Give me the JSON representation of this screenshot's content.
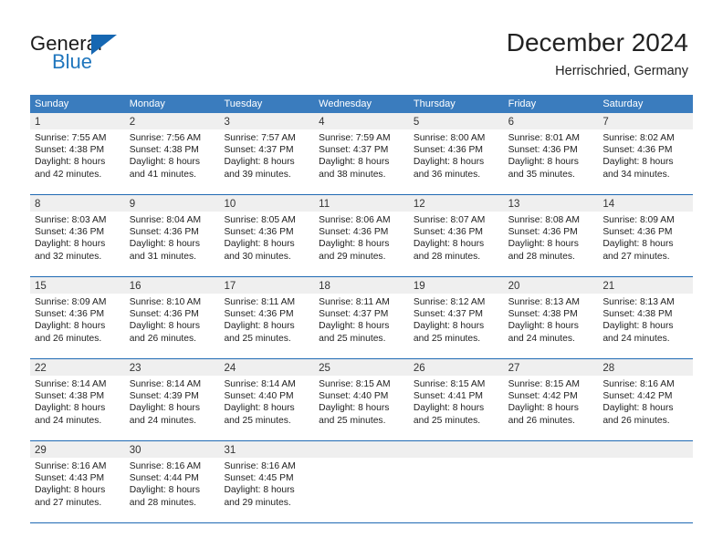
{
  "brand": {
    "name_part1": "General",
    "name_part2": "Blue",
    "triangle_color": "#1667b2",
    "blue_color": "#1f76bd"
  },
  "header": {
    "title": "December 2024",
    "location": "Herrischried, Germany"
  },
  "colors": {
    "header_blue": "#3a7cbe",
    "week_divider": "#1f69b3",
    "daynum_band": "#efefef",
    "text": "#222222"
  },
  "calendar": {
    "weekdays": [
      "Sunday",
      "Monday",
      "Tuesday",
      "Wednesday",
      "Thursday",
      "Friday",
      "Saturday"
    ],
    "weeks": [
      [
        {
          "day": "1",
          "sunrise": "Sunrise: 7:55 AM",
          "sunset": "Sunset: 4:38 PM",
          "daylight1": "Daylight: 8 hours",
          "daylight2": "and 42 minutes."
        },
        {
          "day": "2",
          "sunrise": "Sunrise: 7:56 AM",
          "sunset": "Sunset: 4:38 PM",
          "daylight1": "Daylight: 8 hours",
          "daylight2": "and 41 minutes."
        },
        {
          "day": "3",
          "sunrise": "Sunrise: 7:57 AM",
          "sunset": "Sunset: 4:37 PM",
          "daylight1": "Daylight: 8 hours",
          "daylight2": "and 39 minutes."
        },
        {
          "day": "4",
          "sunrise": "Sunrise: 7:59 AM",
          "sunset": "Sunset: 4:37 PM",
          "daylight1": "Daylight: 8 hours",
          "daylight2": "and 38 minutes."
        },
        {
          "day": "5",
          "sunrise": "Sunrise: 8:00 AM",
          "sunset": "Sunset: 4:36 PM",
          "daylight1": "Daylight: 8 hours",
          "daylight2": "and 36 minutes."
        },
        {
          "day": "6",
          "sunrise": "Sunrise: 8:01 AM",
          "sunset": "Sunset: 4:36 PM",
          "daylight1": "Daylight: 8 hours",
          "daylight2": "and 35 minutes."
        },
        {
          "day": "7",
          "sunrise": "Sunrise: 8:02 AM",
          "sunset": "Sunset: 4:36 PM",
          "daylight1": "Daylight: 8 hours",
          "daylight2": "and 34 minutes."
        }
      ],
      [
        {
          "day": "8",
          "sunrise": "Sunrise: 8:03 AM",
          "sunset": "Sunset: 4:36 PM",
          "daylight1": "Daylight: 8 hours",
          "daylight2": "and 32 minutes."
        },
        {
          "day": "9",
          "sunrise": "Sunrise: 8:04 AM",
          "sunset": "Sunset: 4:36 PM",
          "daylight1": "Daylight: 8 hours",
          "daylight2": "and 31 minutes."
        },
        {
          "day": "10",
          "sunrise": "Sunrise: 8:05 AM",
          "sunset": "Sunset: 4:36 PM",
          "daylight1": "Daylight: 8 hours",
          "daylight2": "and 30 minutes."
        },
        {
          "day": "11",
          "sunrise": "Sunrise: 8:06 AM",
          "sunset": "Sunset: 4:36 PM",
          "daylight1": "Daylight: 8 hours",
          "daylight2": "and 29 minutes."
        },
        {
          "day": "12",
          "sunrise": "Sunrise: 8:07 AM",
          "sunset": "Sunset: 4:36 PM",
          "daylight1": "Daylight: 8 hours",
          "daylight2": "and 28 minutes."
        },
        {
          "day": "13",
          "sunrise": "Sunrise: 8:08 AM",
          "sunset": "Sunset: 4:36 PM",
          "daylight1": "Daylight: 8 hours",
          "daylight2": "and 28 minutes."
        },
        {
          "day": "14",
          "sunrise": "Sunrise: 8:09 AM",
          "sunset": "Sunset: 4:36 PM",
          "daylight1": "Daylight: 8 hours",
          "daylight2": "and 27 minutes."
        }
      ],
      [
        {
          "day": "15",
          "sunrise": "Sunrise: 8:09 AM",
          "sunset": "Sunset: 4:36 PM",
          "daylight1": "Daylight: 8 hours",
          "daylight2": "and 26 minutes."
        },
        {
          "day": "16",
          "sunrise": "Sunrise: 8:10 AM",
          "sunset": "Sunset: 4:36 PM",
          "daylight1": "Daylight: 8 hours",
          "daylight2": "and 26 minutes."
        },
        {
          "day": "17",
          "sunrise": "Sunrise: 8:11 AM",
          "sunset": "Sunset: 4:36 PM",
          "daylight1": "Daylight: 8 hours",
          "daylight2": "and 25 minutes."
        },
        {
          "day": "18",
          "sunrise": "Sunrise: 8:11 AM",
          "sunset": "Sunset: 4:37 PM",
          "daylight1": "Daylight: 8 hours",
          "daylight2": "and 25 minutes."
        },
        {
          "day": "19",
          "sunrise": "Sunrise: 8:12 AM",
          "sunset": "Sunset: 4:37 PM",
          "daylight1": "Daylight: 8 hours",
          "daylight2": "and 25 minutes."
        },
        {
          "day": "20",
          "sunrise": "Sunrise: 8:13 AM",
          "sunset": "Sunset: 4:38 PM",
          "daylight1": "Daylight: 8 hours",
          "daylight2": "and 24 minutes."
        },
        {
          "day": "21",
          "sunrise": "Sunrise: 8:13 AM",
          "sunset": "Sunset: 4:38 PM",
          "daylight1": "Daylight: 8 hours",
          "daylight2": "and 24 minutes."
        }
      ],
      [
        {
          "day": "22",
          "sunrise": "Sunrise: 8:14 AM",
          "sunset": "Sunset: 4:38 PM",
          "daylight1": "Daylight: 8 hours",
          "daylight2": "and 24 minutes."
        },
        {
          "day": "23",
          "sunrise": "Sunrise: 8:14 AM",
          "sunset": "Sunset: 4:39 PM",
          "daylight1": "Daylight: 8 hours",
          "daylight2": "and 24 minutes."
        },
        {
          "day": "24",
          "sunrise": "Sunrise: 8:14 AM",
          "sunset": "Sunset: 4:40 PM",
          "daylight1": "Daylight: 8 hours",
          "daylight2": "and 25 minutes."
        },
        {
          "day": "25",
          "sunrise": "Sunrise: 8:15 AM",
          "sunset": "Sunset: 4:40 PM",
          "daylight1": "Daylight: 8 hours",
          "daylight2": "and 25 minutes."
        },
        {
          "day": "26",
          "sunrise": "Sunrise: 8:15 AM",
          "sunset": "Sunset: 4:41 PM",
          "daylight1": "Daylight: 8 hours",
          "daylight2": "and 25 minutes."
        },
        {
          "day": "27",
          "sunrise": "Sunrise: 8:15 AM",
          "sunset": "Sunset: 4:42 PM",
          "daylight1": "Daylight: 8 hours",
          "daylight2": "and 26 minutes."
        },
        {
          "day": "28",
          "sunrise": "Sunrise: 8:16 AM",
          "sunset": "Sunset: 4:42 PM",
          "daylight1": "Daylight: 8 hours",
          "daylight2": "and 26 minutes."
        }
      ],
      [
        {
          "day": "29",
          "sunrise": "Sunrise: 8:16 AM",
          "sunset": "Sunset: 4:43 PM",
          "daylight1": "Daylight: 8 hours",
          "daylight2": "and 27 minutes."
        },
        {
          "day": "30",
          "sunrise": "Sunrise: 8:16 AM",
          "sunset": "Sunset: 4:44 PM",
          "daylight1": "Daylight: 8 hours",
          "daylight2": "and 28 minutes."
        },
        {
          "day": "31",
          "sunrise": "Sunrise: 8:16 AM",
          "sunset": "Sunset: 4:45 PM",
          "daylight1": "Daylight: 8 hours",
          "daylight2": "and 29 minutes."
        },
        {
          "day": "",
          "sunrise": "",
          "sunset": "",
          "daylight1": "",
          "daylight2": ""
        },
        {
          "day": "",
          "sunrise": "",
          "sunset": "",
          "daylight1": "",
          "daylight2": ""
        },
        {
          "day": "",
          "sunrise": "",
          "sunset": "",
          "daylight1": "",
          "daylight2": ""
        },
        {
          "day": "",
          "sunrise": "",
          "sunset": "",
          "daylight1": "",
          "daylight2": ""
        }
      ]
    ]
  }
}
